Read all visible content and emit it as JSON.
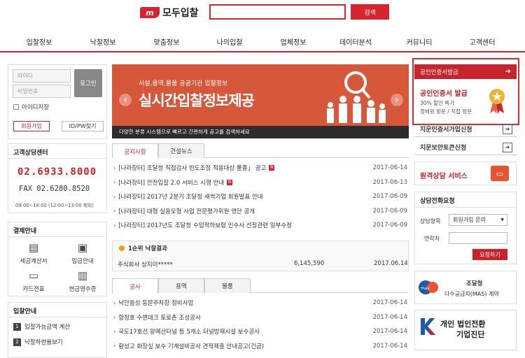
{
  "header": {
    "logo_mark": "m",
    "logo_text": "모두입찰",
    "search_placeholder": "",
    "search_button": "검색"
  },
  "nav": [
    "입찰정보",
    "낙찰정보",
    "맞춤정보",
    "나의입찰",
    "업체정보",
    "데이터분석",
    "커뮤니티",
    "고객센터"
  ],
  "login": {
    "id_placeholder": "아이디",
    "pw_placeholder": "비밀번호",
    "login_button": "로그인",
    "remember": "아이디저장",
    "join": "회원가입",
    "find": "ID/PW찾기"
  },
  "customer": {
    "title": "고객상담센터",
    "phone": "02.6933.8000",
    "fax": "FAX 02.6280.8520",
    "hours": "09:00~18:00 (12:00~13:00 제외)"
  },
  "settle": {
    "title": "결제안내",
    "items": [
      "세금계산서",
      "입금안내",
      "카드전표",
      "현금영수증"
    ]
  },
  "bid_guide": {
    "title": "입찰안내",
    "items": [
      {
        "num": "1",
        "label": "입찰가능금액 계산"
      },
      {
        "num": "2",
        "label": "낙찰하한율보기"
      }
    ]
  },
  "banner": {
    "subtitle": "시설,용역,물품 공공기관 입찰정보",
    "title": "실시간입찰정보제공",
    "caption": "다양한 분류 시스템으로 빠르고 간편하게 공고를 검색하세요",
    "prev": "‹",
    "next": "›"
  },
  "notice": {
    "tabs": [
      "공지사항",
      "건설뉴스"
    ],
    "rows": [
      {
        "text": "[나라장터] 조달청 직접검사 빈도조정 적용대상 품종」 공고",
        "date": "2017-06-14",
        "hot": true
      },
      {
        "text": "[나라장터] 안전입찰 2.0 서비스 시행 안내",
        "date": "2017-06-13",
        "hot": true
      },
      {
        "text": "[나라장터] 2017년 2분기 조달청 새싹기업 회원발표 안내",
        "date": "2017-06-09",
        "hot": false
      },
      {
        "text": "[나라장터] 대형 실용모형 사업 전문평가위원 명단 공개",
        "date": "2017-06-09",
        "hot": false
      },
      {
        "text": "[나라장터] 2017년도 조달청 수입적하보험 인수사 선정관련 일부수정",
        "date": "2017-06-09",
        "hot": false
      }
    ]
  },
  "winner": {
    "title": "1순위 낙찰결과",
    "company": "주식회사 상지이*****",
    "amount": "6,145,590",
    "date": "2017.06.14"
  },
  "bids": {
    "tabs": [
      "공사",
      "용역",
      "물품"
    ],
    "rows": [
      {
        "text": "낙안읍성 동문주차장 정비사업",
        "date": "2017-06-14"
      },
      {
        "text": "합정호 수변데크 토로촌 조성공사",
        "date": "2017-06-14"
      },
      {
        "text": "국도17호선 알메산터널 등 5개소 터널방재시설 보수공사",
        "date": "2017-06-14"
      },
      {
        "text": "황성고 화장실 보수 기계설비공사 견적제출 안내공고(긴급)",
        "date": "2017-06-14"
      }
    ]
  },
  "right": {
    "cert_header": "공인인증서발급",
    "cert_title": "공인인증서 발급",
    "cert_line1": "30% 할인 특가",
    "cert_line2": "정배원 방문 / 직접 방문",
    "links": [
      "지문인증서가입신청",
      "지문보안토큰신청"
    ],
    "remote": "원격상담 서비스",
    "consult_title": "상담전화요청",
    "consult_item_label": "상담항목",
    "consult_item_value": "회원가입 문의",
    "contact_label": "연락처",
    "request_button": "요청하기",
    "mas_title": "조달청",
    "mas_sub": "다수공급자(MAS) 계약",
    "corp_line1": "개인 법인전환",
    "corp_line2": "기업진단"
  },
  "colors": {
    "brand": "#d5262f",
    "banner": "#d7573b",
    "highlight": "#e02a2a"
  }
}
